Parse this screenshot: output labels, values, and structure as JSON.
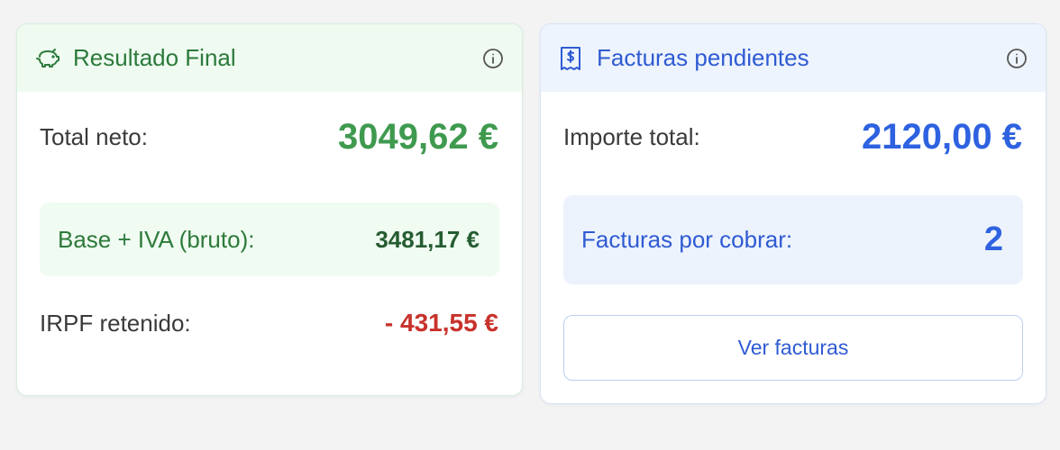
{
  "colors": {
    "green_accent": "#3f9a4f",
    "blue_accent": "#2e62e0",
    "red_value": "#c8322b"
  },
  "result_card": {
    "title": "Resultado Final",
    "icon": "piggy-bank-icon",
    "total_label": "Total neto:",
    "total_value": "3049,62 €",
    "gross_label": "Base + IVA (bruto):",
    "gross_value": "3481,17 €",
    "irpf_label": "IRPF retenido:",
    "irpf_value": "- 431,55 €"
  },
  "pending_card": {
    "title": "Facturas pendientes",
    "icon": "invoice-dollar-icon",
    "total_label": "Importe total:",
    "total_value": "2120,00 €",
    "count_label": "Facturas por cobrar:",
    "count_value": "2",
    "button_label": "Ver facturas"
  }
}
